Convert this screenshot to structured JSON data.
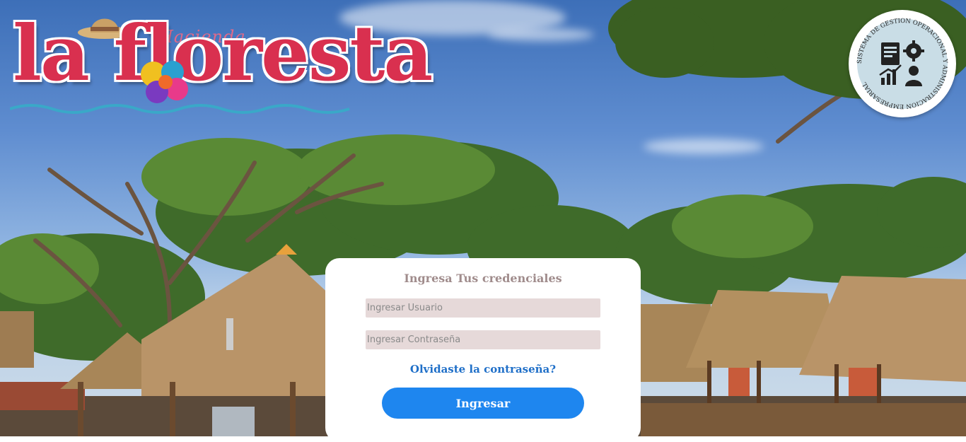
{
  "logo": {
    "subtitle": "Hacienda",
    "title": "la floresta"
  },
  "badge": {
    "text": "SISTEMA DE GESTION OPERACIONAL Y ADMINISTRACION EMPRESARIAL",
    "icons": [
      "document-icon",
      "gear-icon",
      "chart-icon",
      "user-icon"
    ]
  },
  "login": {
    "title": "Ingresa Tus credenciales",
    "username_placeholder": "Ingresar Usuario",
    "username_value": "",
    "password_placeholder": "Ingresar Contraseña",
    "password_value": "",
    "forgot_label": "Olvidaste la contraseña?",
    "submit_label": "Ingresar"
  },
  "colors": {
    "brand": "#d9304f",
    "button": "#1e86ef",
    "link": "#1f6fc8",
    "input_bg": "#e6d9d9",
    "title": "#a08c8c"
  }
}
